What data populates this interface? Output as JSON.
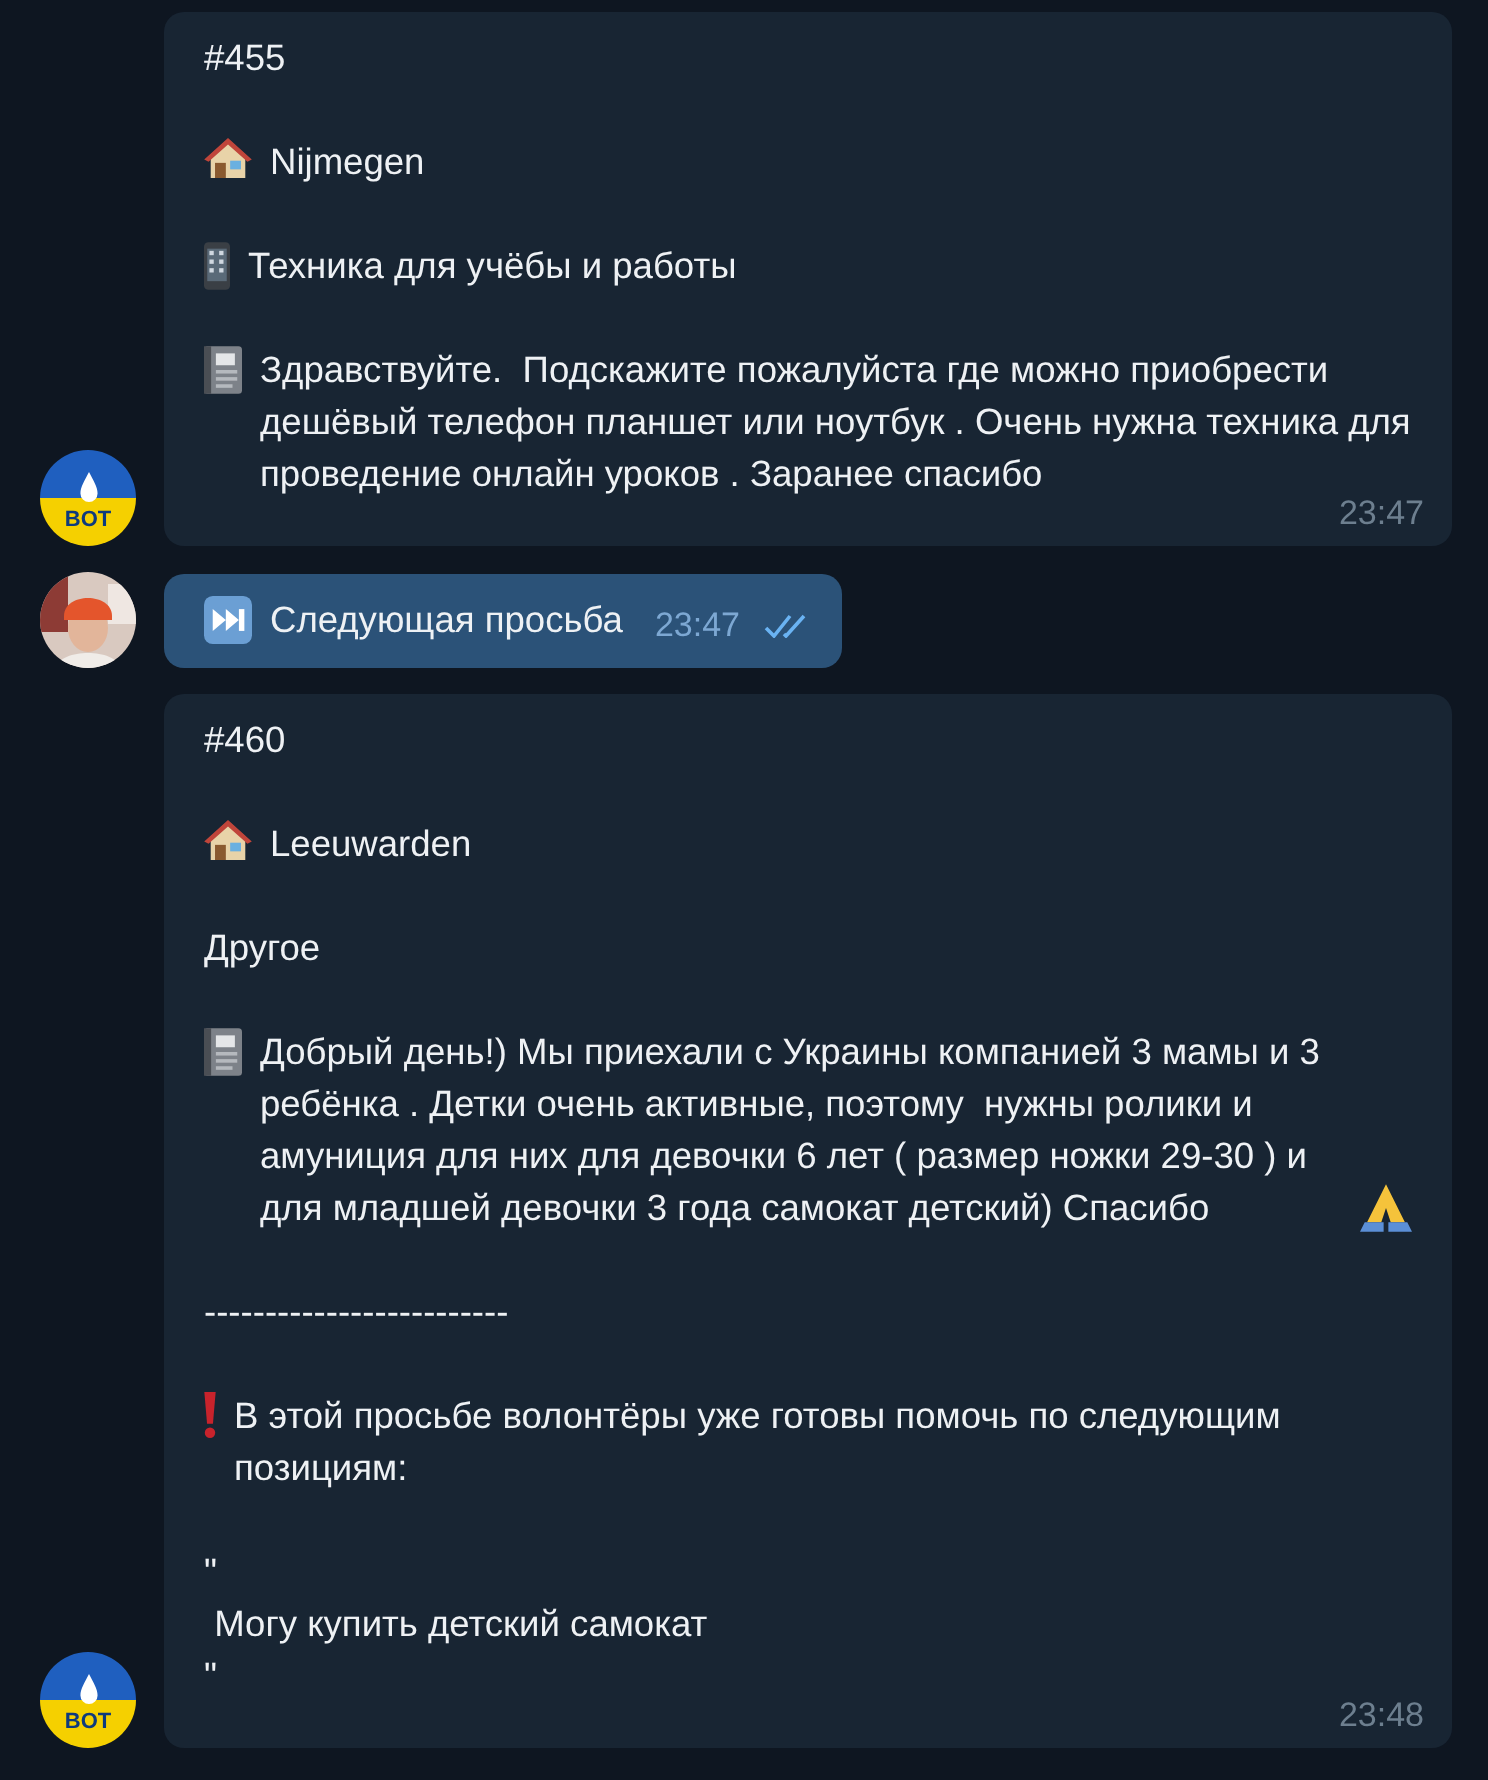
{
  "messages": [
    {
      "outgoing": false,
      "avatar_label": "BOT",
      "paragraphs": [
        {
          "kind": "plain",
          "text": "#455"
        },
        {
          "kind": "house",
          "text": "Nijmegen"
        },
        {
          "kind": "phone",
          "text": "Техника для учёбы и работы"
        },
        {
          "kind": "notebook",
          "text": "Здравствуйте.  Подскажите пожалуйста где можно приобрести дешёвый телефон планшет или ноутбук . Очень нужна техника для проведение онлайн уроков . Заранее спасибо"
        }
      ],
      "time": "23:47"
    },
    {
      "outgoing": true,
      "paragraphs": [
        {
          "kind": "next",
          "text": "Следующая просьба"
        }
      ],
      "time": "23:47",
      "read": true
    },
    {
      "outgoing": false,
      "avatar_label": "BOT",
      "paragraphs": [
        {
          "kind": "plain",
          "text": "#460"
        },
        {
          "kind": "house",
          "text": "Leeuwarden"
        },
        {
          "kind": "plain",
          "text": "Другое"
        },
        {
          "kind": "notebook_thanks",
          "text": "Добрый день!) Мы приехали с Украины компанией 3 мамы и 3 ребёнка . Детки очень активные, поэтому  нужны ролики и амуниция для них для девочки 6 лет ( размер ножки 29-30 ) и для младшей девочки 3 года самокат детский) Спасибо"
        },
        {
          "kind": "plain",
          "text": "-------------------------"
        },
        {
          "kind": "alert",
          "text": "В этой просьбе волонтёры уже готовы помочь по следующим позициям:"
        },
        {
          "kind": "plain",
          "text": "\"\n Могу купить детский самокат\n\""
        }
      ],
      "time": "23:48"
    }
  ]
}
